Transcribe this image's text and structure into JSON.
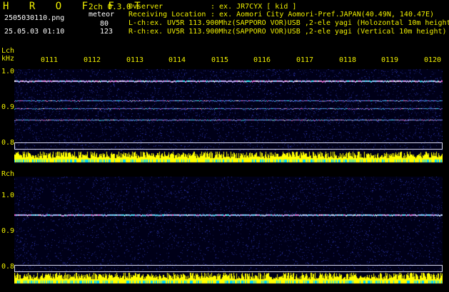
{
  "header": {
    "logo": "H R O F F T",
    "mode": "2ch 0.3.0",
    "filename": "2505030110.png",
    "datetime": "25.05.03 01:10",
    "meteor_label": "meteor",
    "meteor_lch": "80",
    "meteor_rch": "123",
    "observer_label": "Ovserver",
    "observer_value": ": ex. JR7CYX [ kid ]",
    "location_label": "Receiving Location",
    "location_value": ": ex. Aomori City Aomori-Pref.JAPAN(40.49N, 140.47E)",
    "lch_info": "L-ch:ex. UV5R 113.900Mhz(SAPPORO VOR)USB ,2-ele yagi (Holozontal 10m height)",
    "rch_info": "R-ch:ex. UV5R 113.900Mhz(SAPPORO VOR)USB ,2-ele yagi (Vertical 10m height)"
  },
  "lch": {
    "label": "Lch",
    "unit": "kHz",
    "y_labels": [
      "1.0",
      "0.9",
      "0.8"
    ]
  },
  "rch": {
    "label": "Rch",
    "y_labels": [
      "1.0",
      "0.9",
      "0.8"
    ]
  },
  "time_labels": [
    "0111",
    "0112",
    "0113",
    "0114",
    "0115",
    "0116",
    "0117",
    "0118",
    "0119",
    "0120"
  ],
  "colors": {
    "background": "#000000",
    "panel_bg": "#000018",
    "text_yellow": "#f0f000",
    "text_white": "#ffffff",
    "level_yellow": "#ffff00",
    "level_cyan": "#00d8ff",
    "border": "#d8d8f0"
  }
}
